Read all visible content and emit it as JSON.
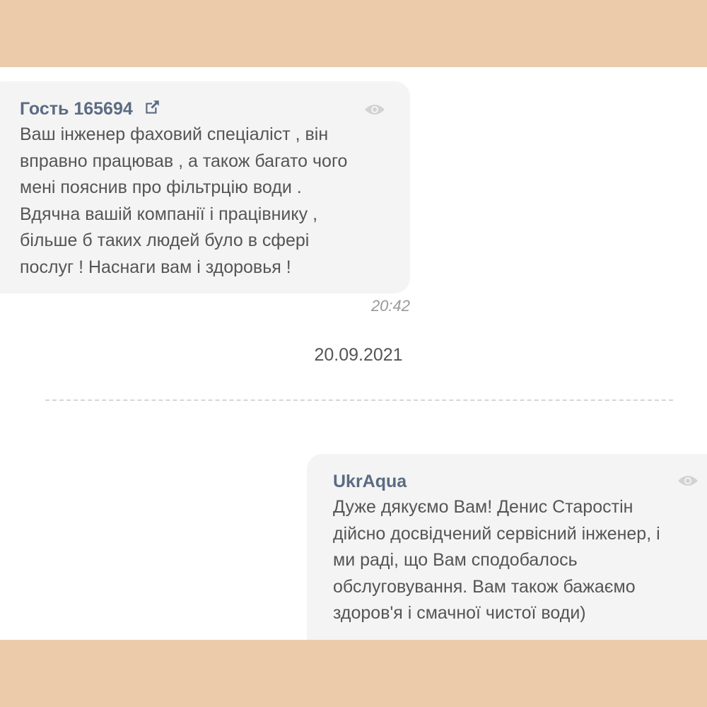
{
  "messages": [
    {
      "author": "Гость 165694",
      "text": "Ваш інженер фаховий спеціаліст , він\nвправно працював , а також багато чого\nмені пояснив про фільтрцію води .\nВдячна вашій компанії і працівнику ,\nбільше б таких людей було в сфері\nпослуг ! Наснаги вам і здоровья !",
      "time": "20:42",
      "icons": [
        "external-link-icon",
        "eye-icon"
      ]
    },
    {
      "author": "UkrAqua",
      "text": "Дуже дякуємо Вам! Денис Старостін\nдійсно досвідчений сервісний інженер, і\nми раді, що Вам сподобалось\nобслуговування. Вам також бажаємо\nздоров'я і смачної чистої води)",
      "icons": [
        "eye-icon"
      ]
    }
  ],
  "date_separator": "20.09.2021",
  "colors": {
    "frame": "#ebcbaa",
    "bubble": "#f4f4f4",
    "author": "#5b6b82",
    "text": "#555555",
    "muted": "#999999"
  }
}
